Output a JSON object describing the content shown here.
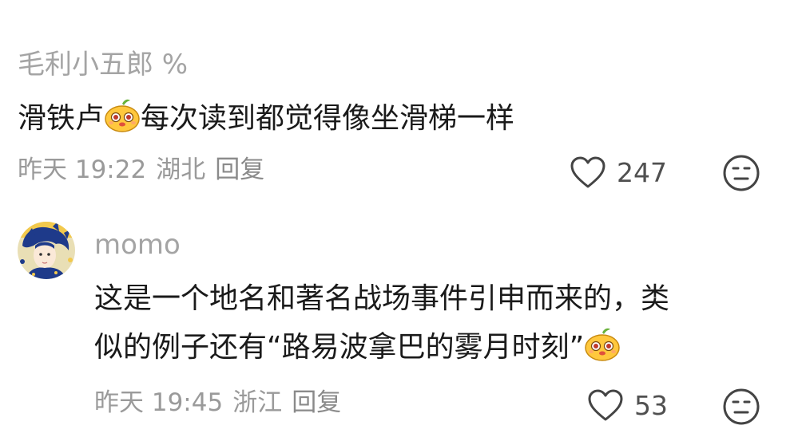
{
  "comments": [
    {
      "username": "毛利小五郎 %",
      "text_before_emoji": "滑铁卢",
      "text_after_emoji": "每次读到都觉得像坐滑梯一样",
      "time": "昨天 19:22",
      "location": "湖北",
      "reply_label": "回复",
      "likes": "247"
    },
    {
      "username": "momo",
      "text_line1": "这是一个地名和著名战场事件引申而来的，类",
      "text_line2": "似的例子还有“路易波拿巴的雾月时刻”",
      "time": "昨天 19:45",
      "location": "浙江",
      "reply_label": "回复",
      "likes": "53"
    }
  ],
  "icons": {
    "emoji": "mango-face-emoji",
    "like": "heart-outline-icon",
    "reaction": "neutral-face-icon"
  },
  "colors": {
    "username": "#a4a4a4",
    "text": "#1a1a1a",
    "meta": "#9a9a9a",
    "icon_stroke": "#444444"
  }
}
